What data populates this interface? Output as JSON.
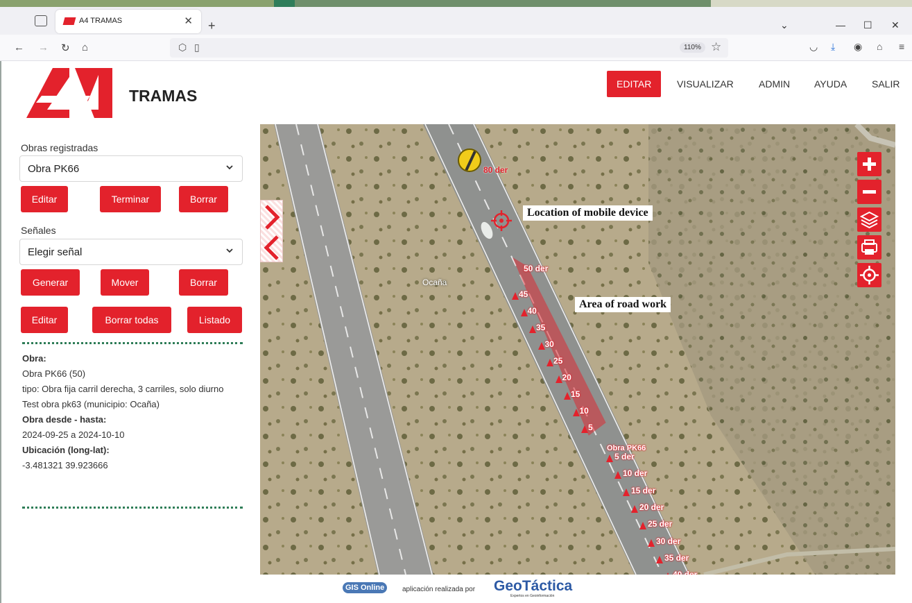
{
  "browser": {
    "tab_title": "A4 TRAMAS",
    "zoom": "110%"
  },
  "app": {
    "brand": "TRAMAS",
    "nav": [
      "EDITAR",
      "VISUALIZAR",
      "ADMIN",
      "AYUDA",
      "SALIR"
    ],
    "active_nav": "EDITAR"
  },
  "sidebar": {
    "obras_label": "Obras registradas",
    "obras_selected": "Obra PK66",
    "obras_buttons": [
      "Editar",
      "Terminar",
      "Borrar"
    ],
    "senales_label": "Señales",
    "senales_selected": "Elegir señal",
    "senales_buttons_row1": [
      "Generar",
      "Mover",
      "Borrar"
    ],
    "senales_buttons_row2": [
      "Editar",
      "Borrar todas",
      "Listado"
    ],
    "info": {
      "obra_heading": "Obra:",
      "obra_name": "Obra PK66 (50)",
      "tipo": "tipo: Obra fija carril derecha, 3 carriles, solo diurno",
      "test": "Test obra pk63 (municipio: Ocaña)",
      "fechas_heading": "Obra desde - hasta:",
      "fechas": "2024-09-25 a 2024-10-10",
      "ubicacion_heading": "Ubicación (long-lat):",
      "ubicacion": "-3.481321 39.923666"
    }
  },
  "map": {
    "place_label": "Ocaña",
    "annotations": {
      "location": "Location of mobile device",
      "area": "Area of road work"
    },
    "marker_top": "80 der",
    "zone_start": "50 der",
    "zone_marks": [
      "45",
      "40",
      "35",
      "30",
      "25",
      "20",
      "15",
      "10",
      "5"
    ],
    "obra_label": "Obra PK66",
    "after_marks": [
      "5 der",
      "10 der",
      "15 der",
      "20 der",
      "25 der",
      "30 der",
      "35 der",
      "40 der"
    ],
    "colors": {
      "brand_red": "#e3222c",
      "dotted_green": "#2e7d57"
    }
  },
  "footer": {
    "gis": "GIS Online",
    "text": "aplicación realizada por",
    "company": "GeoTáctica",
    "tagline": "Expertos en Geoinformación"
  }
}
